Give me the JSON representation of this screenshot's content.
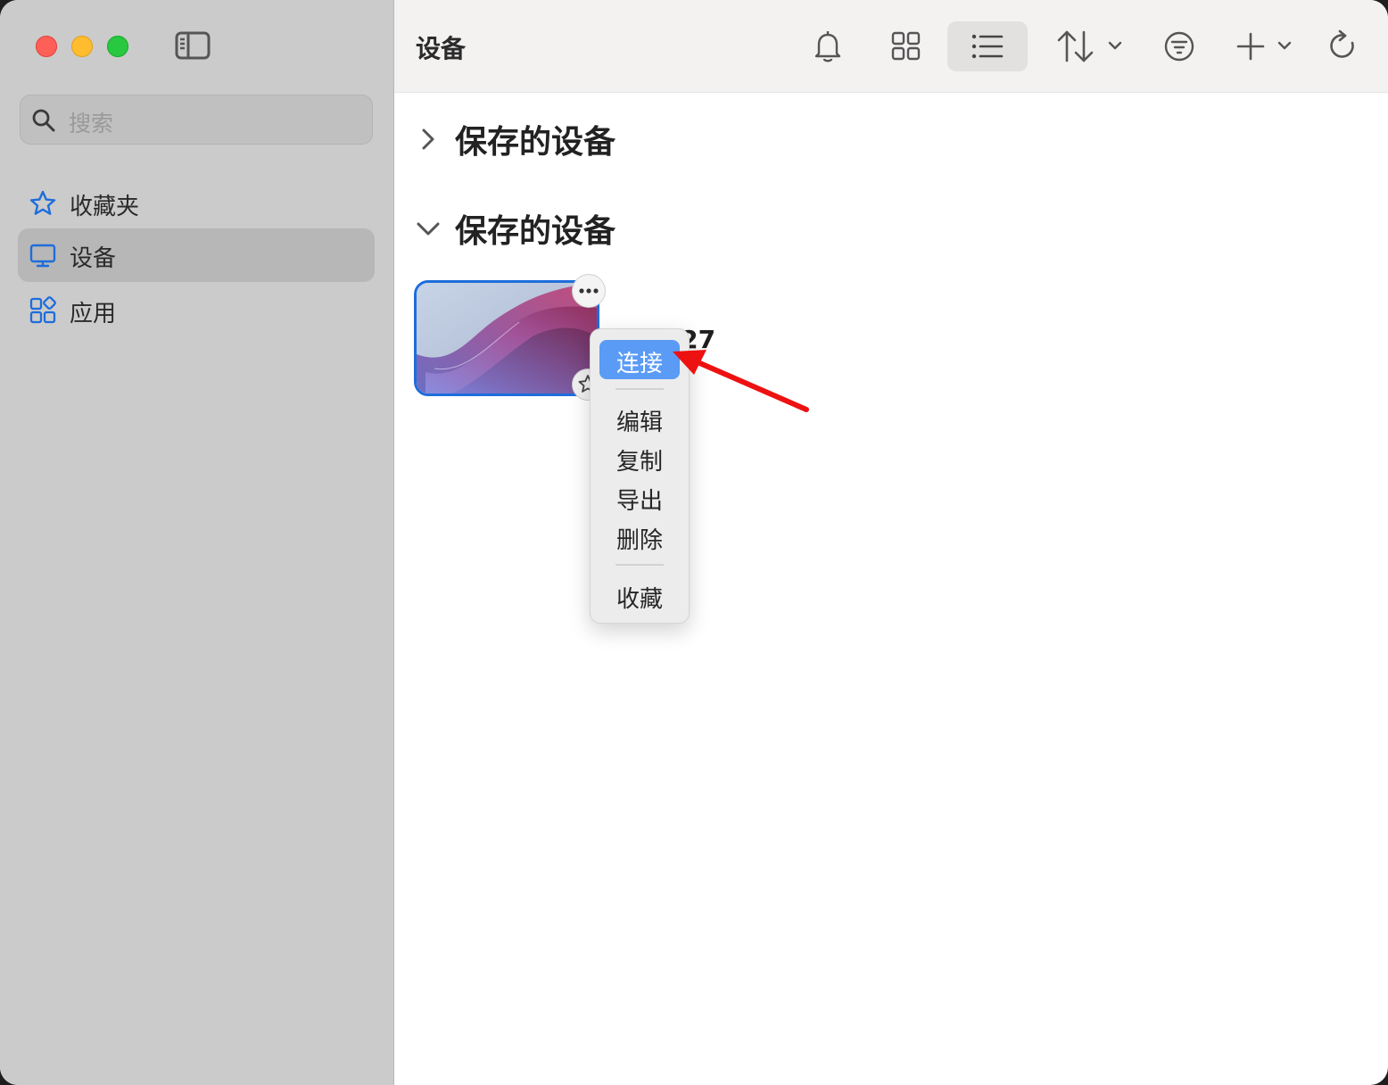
{
  "sidebar": {
    "search_placeholder": "搜索",
    "items": [
      {
        "label": "收藏夹",
        "icon": "star-icon"
      },
      {
        "label": "设备",
        "icon": "monitor-icon",
        "active": true
      },
      {
        "label": "应用",
        "icon": "apps-icon"
      }
    ]
  },
  "toolbar": {
    "title": "设备",
    "buttons": [
      "bell-icon",
      "grid-view-icon",
      "list-view-icon",
      "sort-icon",
      "filter-icon",
      "add-icon",
      "refresh-icon"
    ],
    "active_view": "list-view-icon"
  },
  "sections": [
    {
      "title": "保存的设备",
      "expanded": false
    },
    {
      "title": "保存的设备",
      "expanded": true
    }
  ],
  "device": {
    "name": "37.127"
  },
  "context_menu": {
    "items": [
      {
        "label": "连接",
        "highlighted": true
      },
      {
        "label": "编辑"
      },
      {
        "label": "复制"
      },
      {
        "label": "导出"
      },
      {
        "label": "删除"
      },
      {
        "label": "收藏"
      }
    ]
  },
  "colors": {
    "accent": "#1e6ddb",
    "menu_highlight": "#5a9bf6",
    "annotation_arrow": "#ff0000"
  }
}
